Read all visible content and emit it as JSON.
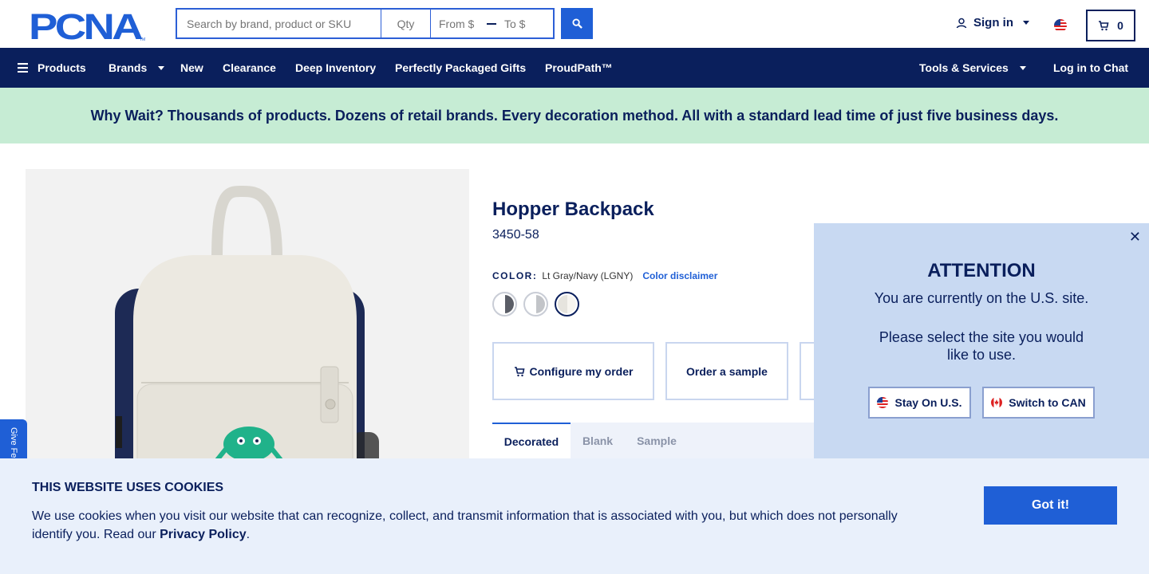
{
  "brand": {
    "logo_text": "PCNA",
    "accent": "#1f5fd6",
    "navy": "#0a1f5c"
  },
  "search": {
    "placeholder": "Search by brand, product or SKU",
    "qty_placeholder": "Qty",
    "from_placeholder": "From $",
    "to_placeholder": "To $",
    "button_icon": "search-icon"
  },
  "header": {
    "signin_label": "Sign in",
    "cart_count": "0"
  },
  "nav": {
    "products": "Products",
    "brands": "Brands",
    "new": "New",
    "clearance": "Clearance",
    "deep_inventory": "Deep Inventory",
    "gifts": "Perfectly Packaged Gifts",
    "proudpath": "ProudPath™",
    "tools": "Tools & Services",
    "chat": "Log in to Chat"
  },
  "promo": {
    "text": "Why Wait? Thousands of products. Dozens of retail brands. Every decoration method. All with a standard lead time of just five business days."
  },
  "product": {
    "title": "Hopper Backpack",
    "sku": "3450-58",
    "color_label": "COLOR:",
    "color_value": "Lt Gray/Navy (LGNY)",
    "color_disclaimer": "Color disclaimer",
    "swatches": [
      {
        "left": "#ffffff",
        "right": "#5a5d66",
        "selected": false
      },
      {
        "left": "#ffffff",
        "right": "#c2c4c8",
        "selected": false
      },
      {
        "left": "#e6e4de",
        "right": "#f7f5f0",
        "selected": true
      }
    ],
    "configure_label": "Configure my order",
    "sample_label": "Order a sample",
    "tabs": [
      "Decorated",
      "Blank",
      "Sample"
    ],
    "active_tab": "Decorated"
  },
  "feedback": {
    "label": "Give Feedback"
  },
  "attention": {
    "title": "ATTENTION",
    "message": "You are currently on the U.S. site.",
    "sub": "Please select the site you would like to use.",
    "stay_label": "Stay On U.S.",
    "switch_label": "Switch to CAN"
  },
  "cookies": {
    "title": "THIS WEBSITE USES COOKIES",
    "text": "We use cookies when you visit our website that can recognize, collect, and transmit information that is associated with you, but which does not personally identify you. Read our ",
    "link": "Privacy Policy",
    "suffix": ".",
    "button": "Got it!"
  }
}
